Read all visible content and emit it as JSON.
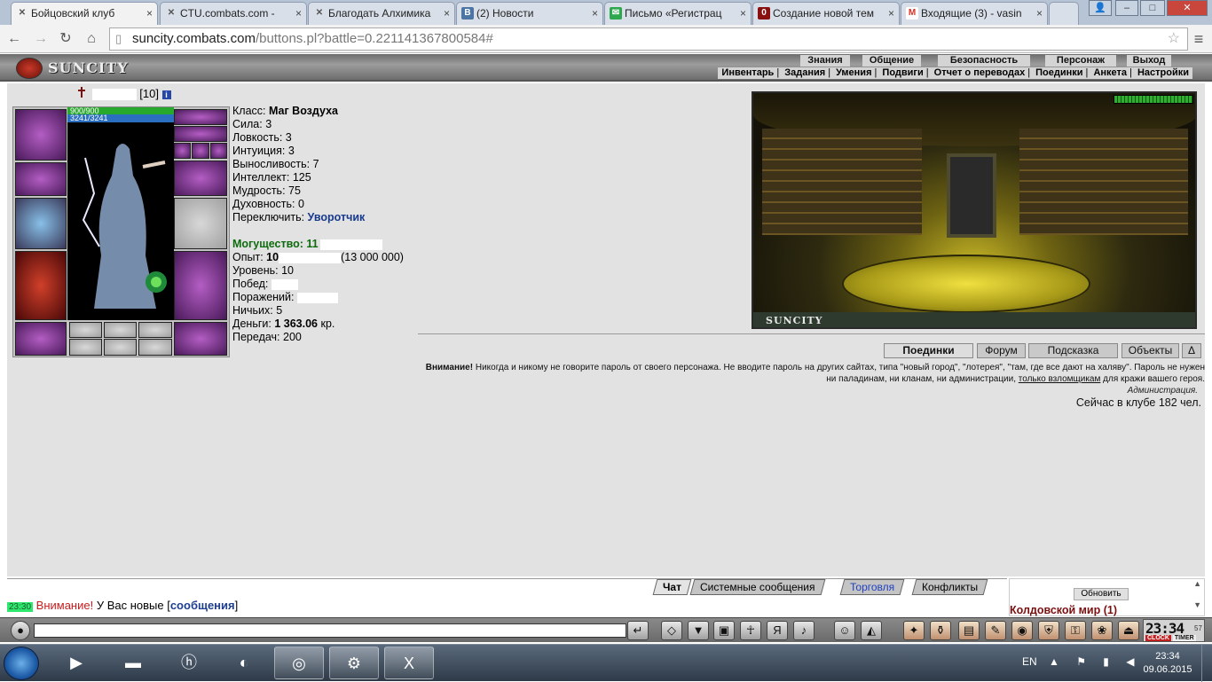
{
  "browser": {
    "tabs": [
      {
        "label": "Бойцовский клуб",
        "icon": "crossed-swords-icon",
        "icon_color": "#555555"
      },
      {
        "label": "CTU.combats.com -",
        "icon": "crossed-swords-icon",
        "icon_color": "#555555"
      },
      {
        "label": "Благодать Алхимика",
        "icon": "crossed-swords-icon",
        "icon_color": "#555555"
      },
      {
        "label": "(2) Новости",
        "icon": "vk-icon",
        "icon_color": "#4c75a3"
      },
      {
        "label": "Письмо «Регистрац",
        "icon": "mail-icon",
        "icon_color": "#2ea84f"
      },
      {
        "label": "Создание новой тем",
        "icon": "forum-icon",
        "icon_color": "#8a1010"
      },
      {
        "label": "Входящие (3) - vasin",
        "icon": "gmail-icon",
        "icon_color": "#d93025"
      }
    ],
    "window_controls": [
      "user-icon",
      "minimize-icon",
      "maximize-icon",
      "close-icon"
    ],
    "url_host": "suncity.combats.com",
    "url_path": "/buttons.pl?battle=0.221141367800584#"
  },
  "game_header": {
    "logo": "SUNCITY",
    "menu_top": [
      "Знания",
      "Общение",
      "Безопасность",
      "Персонаж",
      "Выход"
    ],
    "menu_sub": [
      "Инвентарь",
      "Задания",
      "Умения",
      "Подвиги",
      "Отчет о переводах",
      "Поединки",
      "Анкета",
      "Настройки"
    ]
  },
  "character": {
    "level": "[10]",
    "info_icon": "i",
    "hp": "900/900",
    "mana": "3241/3241",
    "stats": {
      "class_label": "Класс:",
      "class_value": "Маг Воздуха",
      "str": "Сила: 3",
      "agi": "Ловкость: 3",
      "int": "Интуиция: 3",
      "end": "Выносливость: 7",
      "intel": "Интеллект: 125",
      "wis": "Мудрость: 75",
      "spirit": "Духовность: 0",
      "switch_label": "Переключить:",
      "switch_value": "Уворотчик",
      "power_label": "Могущество: 11",
      "exp_label": "Опыт:",
      "exp_value": "10",
      "exp_next": "(13 000 000)",
      "lvl": "Уровень: 10",
      "wins": "Побед:",
      "losses": "Поражений:",
      "draws": "Ничьих: 5",
      "money_label": "Деньги:",
      "money_value": "1 363.06",
      "money_unit": "кр.",
      "transfers": "Передач: 200"
    }
  },
  "scene": {
    "caption": "SUNCITY"
  },
  "room_buttons": [
    "Поединки",
    "Форум",
    "Подсказка",
    "Объекты",
    "Δ"
  ],
  "notice": {
    "bold": "Внимание!",
    "text1": " Никогда и никому не говорите пароль от своего персонажа. Не вводите пароль на других сайтах, типа \"новый город\", \"лотерея\", \"там, где все дают на халяву\". Пароль не нужен ни паладинам, ни кланам, ни администрации, ",
    "link": "только взломщикам",
    "text2": " для кражи вашего героя.",
    "signature": "Администрация.",
    "online": "Сейчас в клубе 182 чел."
  },
  "chat": {
    "tabs": [
      "Чат",
      "Системные сообщения",
      "Торговля",
      "Конфликты"
    ],
    "time": "23:30",
    "msg_red": "Внимание!",
    "msg_mid": " У Вас новые [",
    "msg_link": "сообщения",
    "msg_end": "]"
  },
  "right_panel": {
    "refresh": "Обновить",
    "world": "Колдовской мир (1)"
  },
  "clock": {
    "time": "23:34",
    "seconds": "57",
    "clock_label": "CLOCK",
    "timer_label": "TIMER"
  },
  "taskbar": {
    "apps": [
      "media-player-icon",
      "explorer-icon",
      "hp-icon",
      "firefox-icon",
      "chrome-icon",
      "steam-icon",
      "excel-icon"
    ],
    "lang": "EN",
    "time": "23:34",
    "date": "09.06.2015"
  }
}
